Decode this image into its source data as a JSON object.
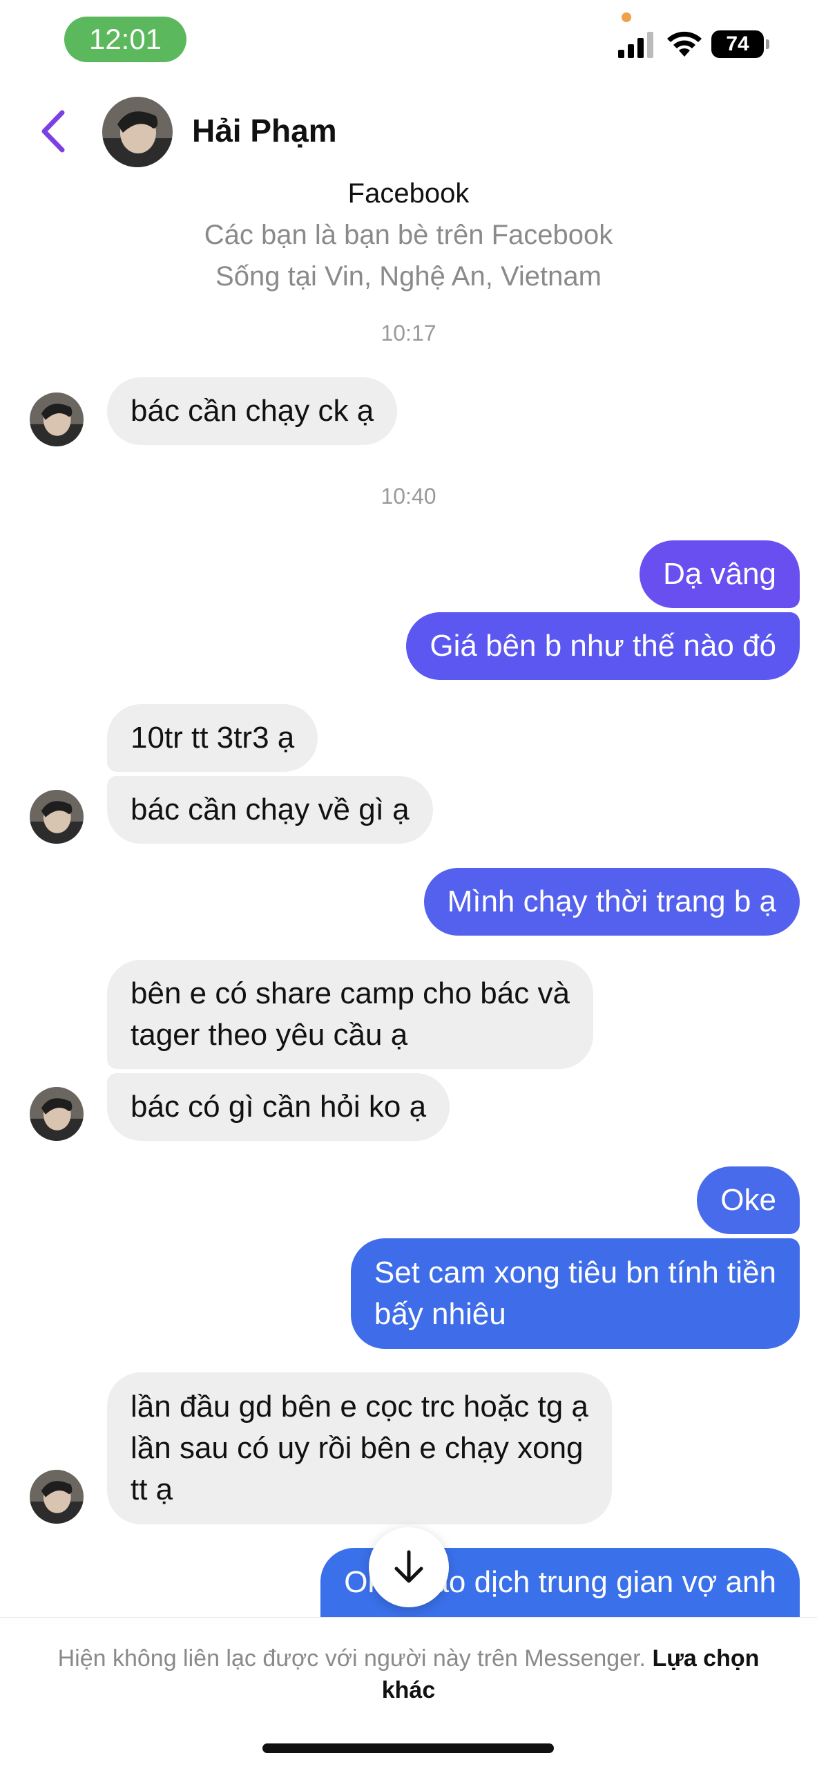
{
  "status_bar": {
    "time": "12:01",
    "battery": "74",
    "icons": [
      "signal-icon",
      "wifi-icon",
      "battery-icon"
    ]
  },
  "header": {
    "contact_name": "Hải Phạm",
    "back_icon": "chevron-left-icon",
    "accent_color": "#7b3fe4"
  },
  "profile": {
    "source": "Facebook",
    "friends": "Các bạn là bạn bè trên Facebook",
    "lives": "Sống tại Vin, Nghệ An, Vietnam"
  },
  "timestamps": [
    "10:17",
    "10:40"
  ],
  "messages": [
    {
      "side": "in",
      "text": "bác cần chạy ck ạ"
    },
    {
      "side": "out",
      "text": "Dạ vâng"
    },
    {
      "side": "out",
      "text": "Giá bên b như thế nào đó"
    },
    {
      "side": "in",
      "text": "10tr tt 3tr3 ạ"
    },
    {
      "side": "in",
      "text": "bác cần chạy về gì ạ"
    },
    {
      "side": "out",
      "text": "Mình chạy thời trang b ạ"
    },
    {
      "side": "in",
      "lines": [
        "bên e có share camp cho bác và",
        "tager theo yêu cầu ạ"
      ]
    },
    {
      "side": "in",
      "text": "bác có gì cần hỏi ko ạ"
    },
    {
      "side": "out",
      "text": "Oke"
    },
    {
      "side": "out",
      "lines": [
        "Set cam xong tiêu bn tính tiền",
        "bấy nhiêu"
      ]
    },
    {
      "side": "in",
      "lines": [
        "lần đầu gd bên e cọc trc hoặc tg ạ",
        "lần sau có uy rồi bên e chạy xong",
        "tt ạ"
      ]
    },
    {
      "side": "out",
      "text": "Oke giao dịch trung gian vợ anh"
    }
  ],
  "scroll_button_icon": "arrow-down-icon",
  "footer": {
    "notice": "Hiện không liên lạc được với người này trên Messenger.",
    "link": "Lựa chọn khác"
  },
  "colors": {
    "bubble_in": "#eeeeee",
    "bubble_out_purple": "#6a4ff0",
    "bubble_out_blue": "#3b6fe8",
    "time_pill": "#5cb85c"
  }
}
